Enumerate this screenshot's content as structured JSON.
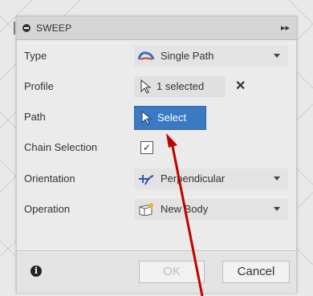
{
  "dialog": {
    "title": "SWEEP",
    "collapse_icon": "double-chevron-right-icon"
  },
  "rows": {
    "type": {
      "label": "Type",
      "value": "Single Path",
      "icon": "single-path-icon"
    },
    "profile": {
      "label": "Profile",
      "value": "1 selected",
      "icon": "cursor-icon",
      "clear": "✕"
    },
    "path": {
      "label": "Path",
      "value": "Select",
      "icon": "cursor-icon"
    },
    "chain": {
      "label": "Chain Selection",
      "checked": true,
      "check_mark": "✓"
    },
    "orientation": {
      "label": "Orientation",
      "value": "Perpendicular",
      "icon": "perpendicular-icon"
    },
    "operation": {
      "label": "Operation",
      "value": "New Body",
      "icon": "new-body-icon"
    }
  },
  "footer": {
    "info": "i",
    "ok_label": "OK",
    "cancel_label": "Cancel"
  },
  "colors": {
    "accent": "#3b7ac2",
    "annotation_arrow": "#c00000"
  }
}
